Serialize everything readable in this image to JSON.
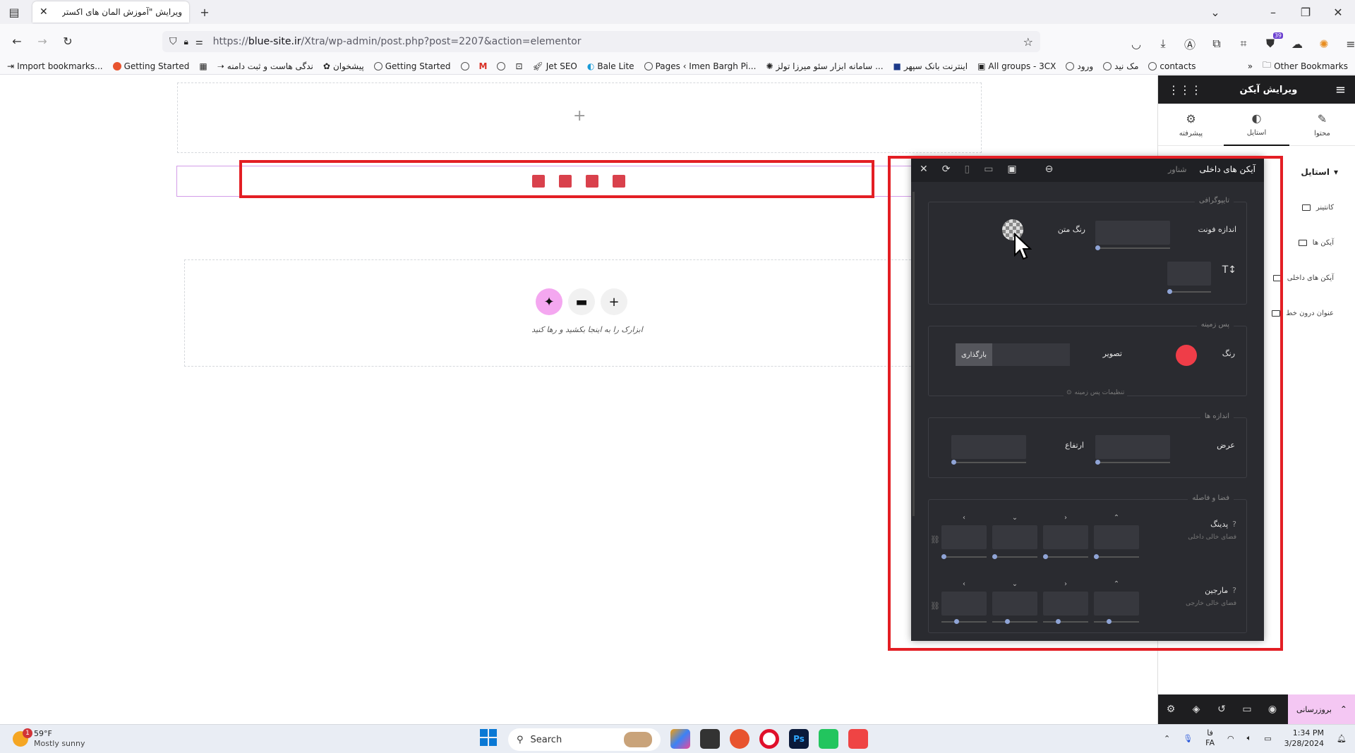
{
  "browser": {
    "tab_title": "ویرایش \"آموزش المان های اکسترا – ع",
    "url_prefix": "https://",
    "url_domain": "blue-site.ir",
    "url_path": "/Xtra/wp-admin/post.php?post=2207&action=elementor",
    "extension_badge": "39",
    "bookmarks": [
      "Import bookmarks...",
      "Getting Started",
      "ندگی هاست و ثبت دامنه",
      "پیشخوان",
      "Getting Started",
      "Jet SEO",
      "Bale Lite",
      "Pages ‹ Imen Bargh Pi...",
      "سامانه ابزار سئو میرزا تولز ...",
      "اینترنت بانک سپهر",
      "All groups - 3CX",
      "ورود",
      "مک نید",
      "contacts"
    ],
    "other_bookmarks": "Other Bookmarks"
  },
  "canvas": {
    "drop_hint": "ابزارک را به اینجا بکشید و رها کنید"
  },
  "elementor_panel": {
    "title": "ویرایش آیکن",
    "tabs": [
      "محتوا",
      "استایل",
      "پیشرفته"
    ],
    "style_heading": "استایل",
    "sections": [
      "کانتینر",
      "آیکن ها",
      "آیکن های داخلی",
      "عنوان درون خط"
    ],
    "update_label": "بروزرسانی"
  },
  "float_panel": {
    "title": "آیکن های داخلی",
    "subtitle": "شناور",
    "typography": {
      "legend": "تایپوگرافی",
      "font_size": "اندازه فونت",
      "text_color": "رنگ متن"
    },
    "background": {
      "legend": "پس زمینه",
      "color": "رنگ",
      "image": "تصویر",
      "upload": "بارگذاری",
      "settings": "تنظیمات پس زمینه",
      "color_value": "#ef3d48"
    },
    "sizes": {
      "legend": "اندازه ها",
      "width": "عرض",
      "height": "ارتفاع"
    },
    "spacing": {
      "legend": "فضا و فاصله",
      "padding": "پدینگ",
      "padding_sub": "فضای خالی داخلی",
      "margin": "مارجین",
      "margin_sub": "فضای خالی خارجی"
    }
  },
  "taskbar": {
    "temp": "59°F",
    "weather": "Mostly sunny",
    "weather_badge": "1",
    "search": "Search",
    "lang_top": "فا",
    "lang_bottom": "FA",
    "time": "1:34 PM",
    "date": "3/28/2024"
  },
  "colors": {
    "accent_pink": "#f4c7f3",
    "highlight_red": "#e31e24",
    "icon_red": "#d9414c"
  }
}
